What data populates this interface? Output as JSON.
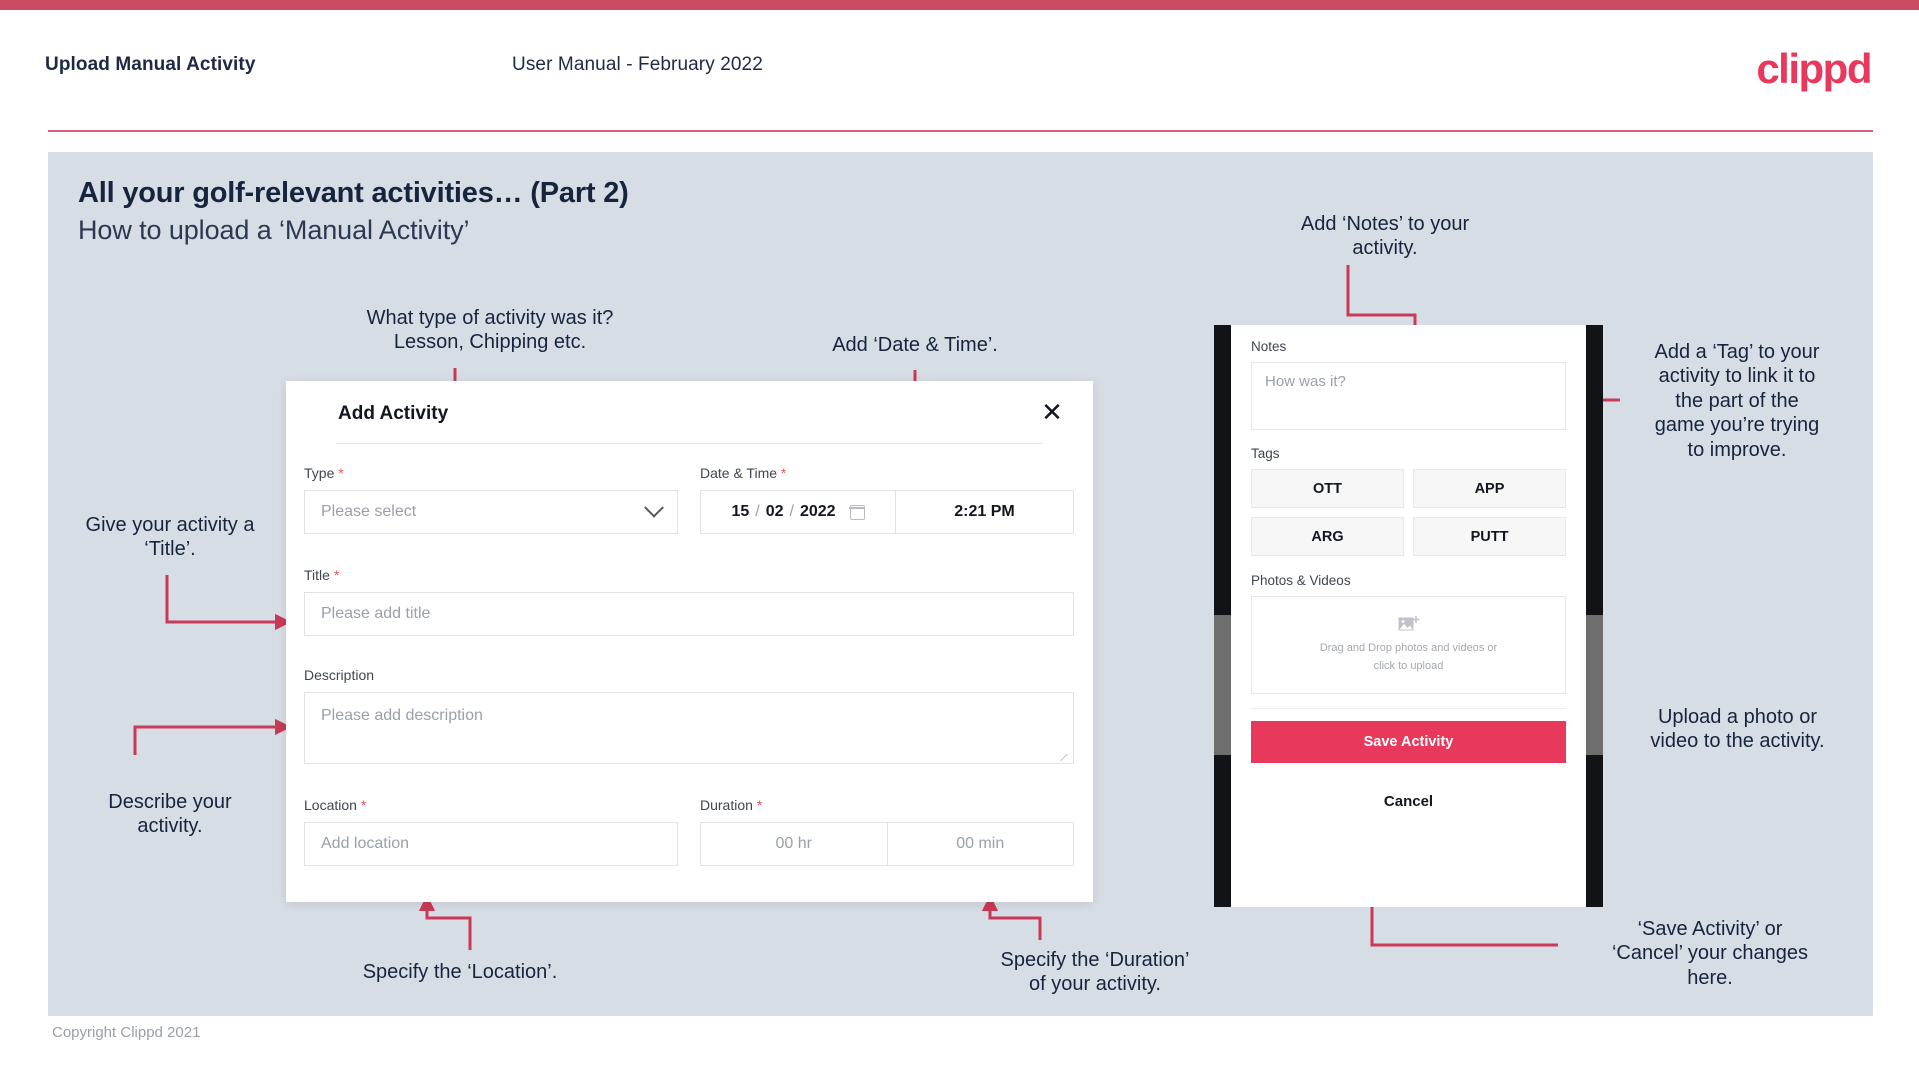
{
  "header": {
    "title": "Upload Manual Activity",
    "subtitle": "User Manual - February 2022",
    "logo": "clippd"
  },
  "slide": {
    "title": "All your golf-relevant activities… (Part 2)",
    "subtitle": "How to upload a ‘Manual Activity’"
  },
  "annotations": {
    "type": "What type of activity was it?\nLesson, Chipping etc.",
    "datetime": "Add ‘Date & Time’.",
    "title_field": "Give your activity a\n‘Title’.",
    "description": "Describe your\nactivity.",
    "location": "Specify the ‘Location’.",
    "duration": "Specify the ‘Duration’\nof your activity.",
    "notes": "Add ‘Notes’ to your\nactivity.",
    "tags": "Add a ‘Tag’ to your\nactivity to link it to\nthe part of the\ngame you’re trying\nto improve.",
    "upload": "Upload a photo or\nvideo to the activity.",
    "save_cancel": "‘Save Activity’ or\n‘Cancel’ your changes\nhere."
  },
  "dialog": {
    "title": "Add Activity",
    "close_icon": "close-icon",
    "fields": {
      "type": {
        "label": "Type",
        "required": "*",
        "placeholder": "Please select"
      },
      "datetime": {
        "label": "Date & Time",
        "required": "*",
        "day": "15",
        "month": "02",
        "year": "2022",
        "sep": "/",
        "time": "2:21 PM"
      },
      "title": {
        "label": "Title",
        "required": "*",
        "placeholder": "Please add title"
      },
      "description": {
        "label": "Description",
        "placeholder": "Please add description"
      },
      "location": {
        "label": "Location",
        "required": "*",
        "placeholder": "Add location"
      },
      "duration": {
        "label": "Duration",
        "required": "*",
        "hours": "00 hr",
        "minutes": "00 min"
      }
    }
  },
  "phone": {
    "notes": {
      "label": "Notes",
      "placeholder": "How was it?"
    },
    "tags": {
      "label": "Tags",
      "items": [
        "OTT",
        "APP",
        "ARG",
        "PUTT"
      ]
    },
    "photos": {
      "label": "Photos & Videos",
      "dropzone_line1": "Drag and Drop photos and videos or",
      "dropzone_line2": "click to upload",
      "icon": "add-image-icon"
    },
    "save_label": "Save Activity",
    "cancel_label": "Cancel"
  },
  "footer": {
    "copyright": "Copyright Clippd 2021"
  },
  "colors": {
    "brand_pink": "#e8385c",
    "top_bar": "#cc4b63",
    "slide_bg": "#d7dde5",
    "text_dark": "#17243d",
    "arrow": "#c93a57"
  }
}
